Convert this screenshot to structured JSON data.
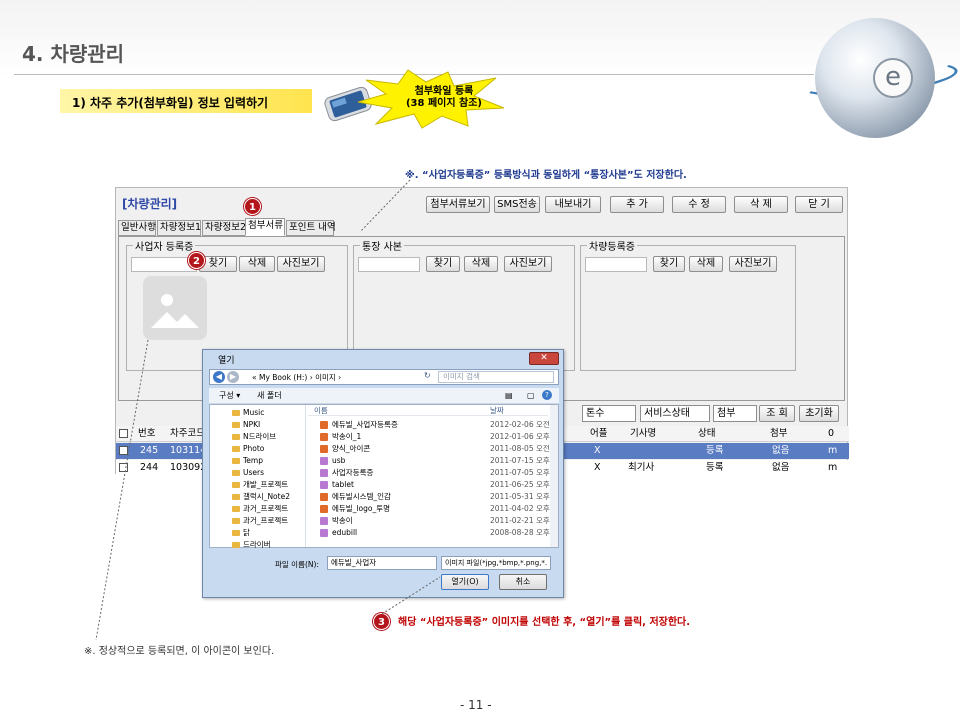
{
  "page": {
    "title": "4. 차량관리",
    "subtitle": "1) 차주 추가(첨부화일) 정보 입력하기",
    "callout_line1": "첨부화일 등록",
    "callout_line2": "(38 페이지 참조)",
    "note_top": "※. “사업자등록증” 등록방식과 동일하게 “통장사본”도 저장한다.",
    "note_step3": "해당 “사업자등록증” 이미지를 선택한 후, “열기”를 클릭, 저장한다.",
    "note_bottom_left": "※. 정상적으로 등록되면, 이 아이콘이 보인다.",
    "footer": "- 11 -",
    "markers": [
      "1",
      "2",
      "3"
    ]
  },
  "app": {
    "title": "[차량관리]",
    "toolbar": [
      "첨부서류보기",
      "SMS전송",
      "내보내기",
      "추 가",
      "수 정",
      "삭 제",
      "닫 기"
    ],
    "tabs": [
      "일반사항",
      "차량정보1",
      "차량정보2",
      "첨부서류",
      "포인트 내역"
    ],
    "active_tab": "첨부서류",
    "groups": [
      {
        "title": "사업자 등록증",
        "buttons": [
          "찾기",
          "삭제",
          "사진보기"
        ]
      },
      {
        "title": "통장 사본",
        "buttons": [
          "찾기",
          "삭제",
          "사진보기"
        ]
      },
      {
        "title": "차량등록증",
        "buttons": [
          "찾기",
          "삭제",
          "사진보기"
        ]
      }
    ],
    "filters": [
      "톤수",
      "서비스상태",
      "첨부"
    ],
    "filter_buttons": [
      "조 회",
      "초기화"
    ],
    "grid": {
      "header_left": [
        "번호",
        "차주코드"
      ],
      "header_right": [
        "어플",
        "기사명",
        "상태",
        "첨부",
        "0"
      ],
      "rows": [
        {
          "no": "245",
          "code": "103114",
          "app": "X",
          "driver": "",
          "status": "등록",
          "attach": "없음",
          "extra": "m",
          "selected": true
        },
        {
          "no": "244",
          "code": "103092",
          "app": "X",
          "driver": "최기사",
          "status": "등록",
          "attach": "없음",
          "extra": "m",
          "selected": false
        }
      ]
    }
  },
  "dialog": {
    "title": "열기",
    "path": "« My Book (H:) › 이미지 ›",
    "search_placeholder": "이미지 검색",
    "toolbar_organize": "구성 ▾",
    "toolbar_newfolder": "새 폴더",
    "col_name": "이름",
    "col_date": "날짜",
    "folders": [
      "Music",
      "NPKI",
      "N드라이브",
      "Photo",
      "Temp",
      "Users",
      "개발_프로젝트",
      "갤럭시_Note2",
      "과거_프로젝트",
      "과거_프로젝트",
      "닭",
      "드라이버"
    ],
    "files": [
      {
        "name": "에듀빌_사업자등록증",
        "date": "2012-02-06 오전 11:"
      },
      {
        "name": "박송이_1",
        "date": "2012-01-06 오후 2:"
      },
      {
        "name": "양식_아이콘",
        "date": "2011-08-05 오전 11:"
      },
      {
        "name": "usb",
        "date": "2011-07-15 오후 1:"
      },
      {
        "name": "사업자등록증",
        "date": "2011-07-05 오후 3:"
      },
      {
        "name": "tablet",
        "date": "2011-06-25 오후 1:"
      },
      {
        "name": "에듀빌시스템_인감",
        "date": "2011-05-31 오후 7:"
      },
      {
        "name": "에듀빌_logo_투명",
        "date": "2011-04-02 오후 1:"
      },
      {
        "name": "박송이",
        "date": "2011-02-21 오후 6:"
      },
      {
        "name": "edubill",
        "date": "2008-08-28 오후 4:"
      }
    ],
    "filename_label": "파일 이름(N):",
    "filename_value": "에듀빌_사업자",
    "filetype_value": "이미지 파일(*jpg,*bmp,*.png,*.",
    "open_button": "열기(O)",
    "cancel_button": "취소"
  }
}
